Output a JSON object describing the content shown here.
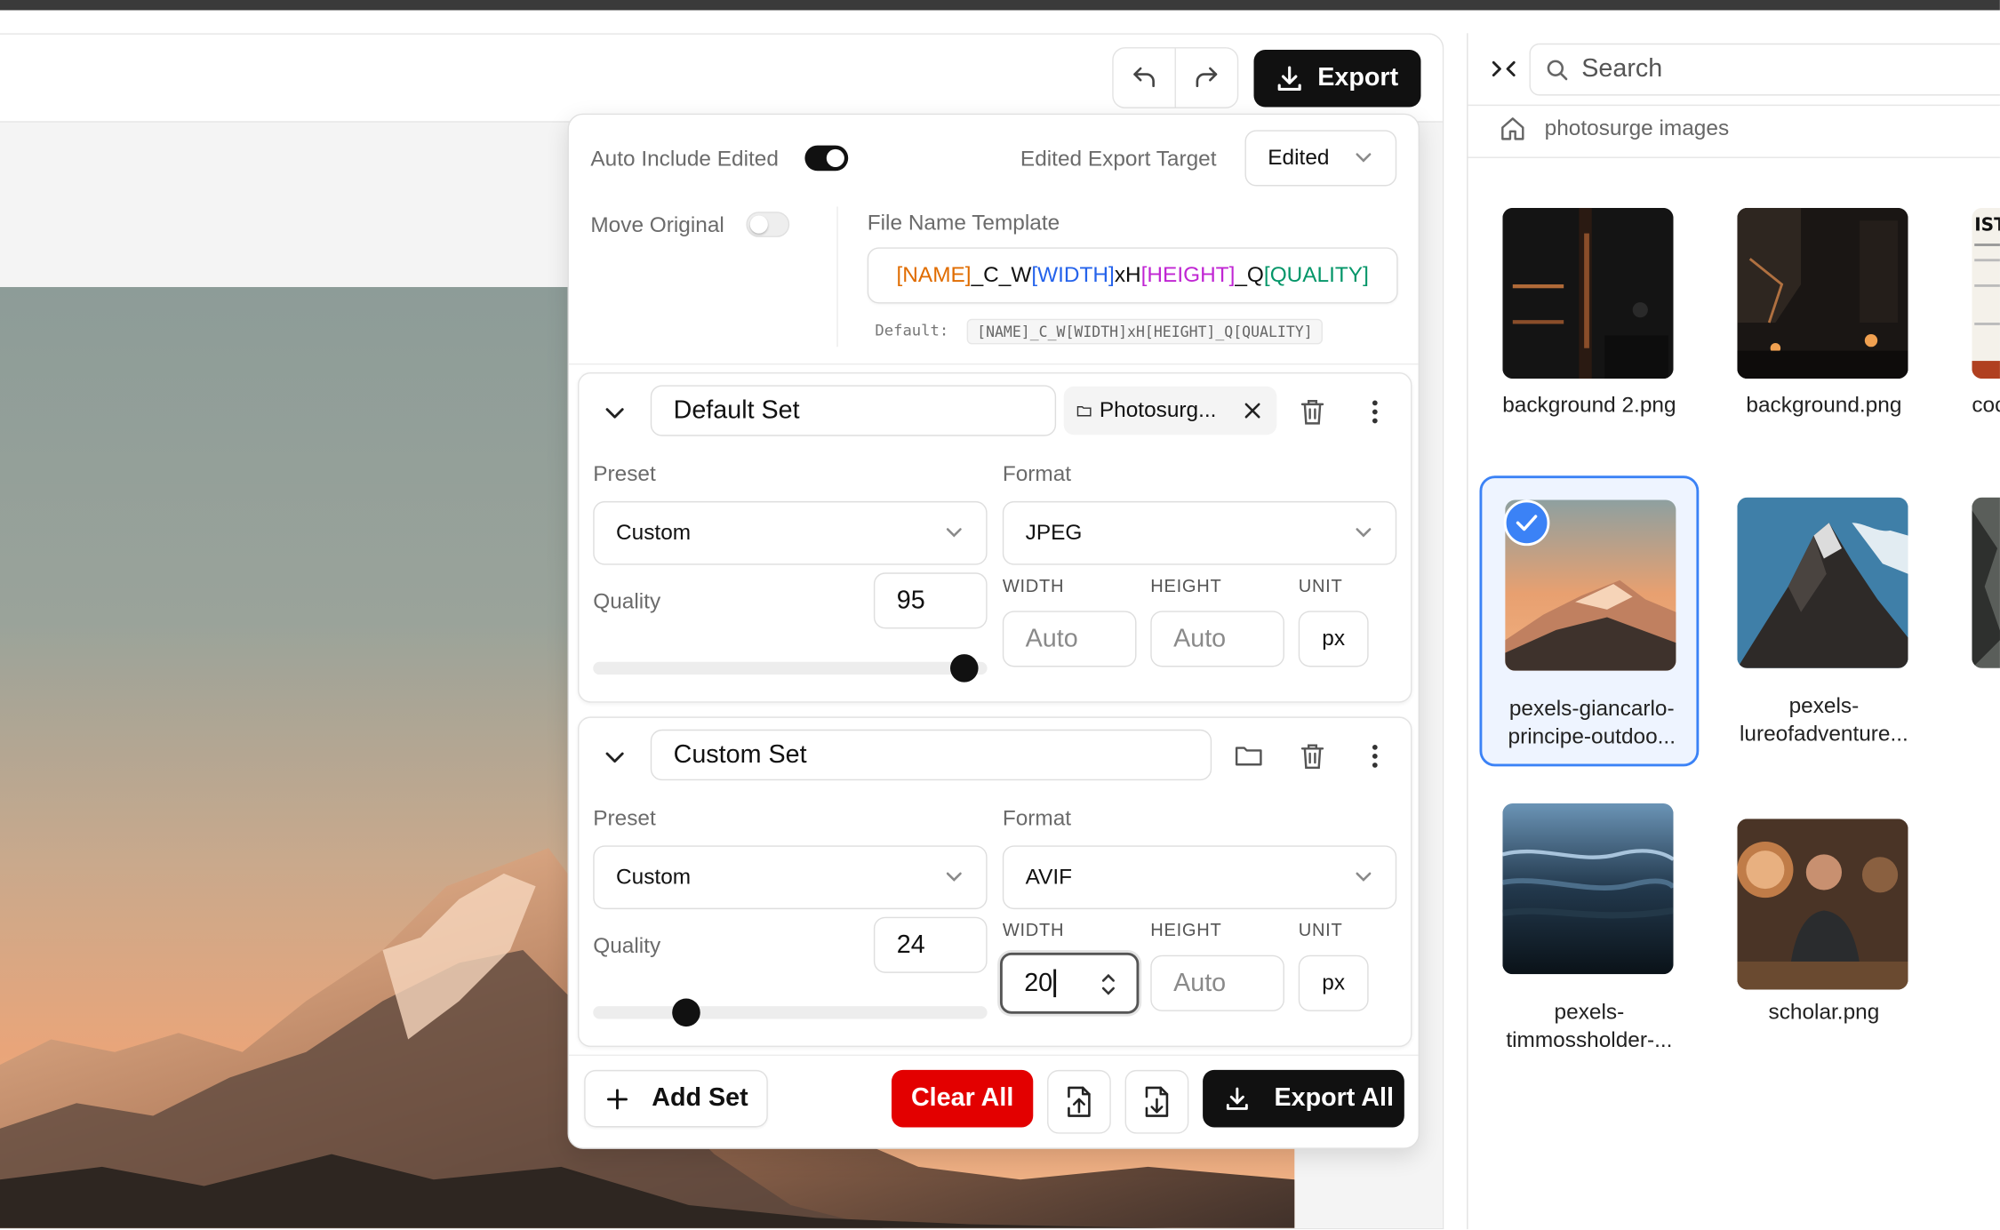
{
  "toolbar": {
    "export_label": "Export"
  },
  "export_panel": {
    "auto_include_label": "Auto Include Edited",
    "auto_include_on": true,
    "edited_target_label": "Edited Export Target",
    "edited_target_value": "Edited",
    "move_original_label": "Move Original",
    "move_original_on": false,
    "file_name_template_label": "File Name Template",
    "template_tokens": [
      "[NAME]",
      "_C_W",
      "[WIDTH]",
      "xH",
      "[HEIGHT]",
      "_Q",
      "[QUALITY]"
    ],
    "default_label": "Default:",
    "default_value": "[NAME]_C_W[WIDTH]xH[HEIGHT]_Q[QUALITY]",
    "sets": [
      {
        "name": "Default Set",
        "folder": "Photosurg...",
        "preset_label": "Preset",
        "preset_value": "Custom",
        "format_label": "Format",
        "format_value": "JPEG",
        "quality_label": "Quality",
        "quality_value": "95",
        "quality_fraction": 0.95,
        "width_label": "WIDTH",
        "width_value": "Auto",
        "height_label": "HEIGHT",
        "height_value": "Auto",
        "unit_label": "UNIT",
        "unit_value": "px"
      },
      {
        "name": "Custom Set",
        "preset_label": "Preset",
        "preset_value": "Custom",
        "format_label": "Format",
        "format_value": "AVIF",
        "quality_label": "Quality",
        "quality_value": "24",
        "quality_fraction": 0.24,
        "width_label": "WIDTH",
        "width_value": "20",
        "height_label": "HEIGHT",
        "height_value": "Auto",
        "unit_label": "UNIT",
        "unit_value": "px"
      }
    ],
    "add_set_label": "Add Set",
    "clear_all_label": "Clear All",
    "export_all_label": "Export All",
    "colors": {
      "name_token": "#e06c00",
      "width_token": "#2563eb",
      "height_token": "#c026d3",
      "quality_token": "#059669",
      "clear_all": "#e30000",
      "selected": "#3b82f6"
    }
  },
  "sidebar": {
    "search_placeholder": "Search",
    "breadcrumb": "photosurge images",
    "files": [
      {
        "caption_lines": [
          "background 2.png"
        ],
        "selected": false
      },
      {
        "caption_lines": [
          "background.png"
        ],
        "selected": false
      },
      {
        "caption_lines": [
          "coc"
        ],
        "selected": false
      },
      {
        "caption_lines": [
          "pexels-giancarlo-",
          "principe-outdoo..."
        ],
        "selected": true
      },
      {
        "caption_lines": [
          "pexels-",
          "lureofadventure..."
        ],
        "selected": false
      },
      {
        "caption_lines": [
          "pexels-",
          "timmossholder-..."
        ],
        "selected": false
      },
      {
        "caption_lines": [
          "scholar.png"
        ],
        "selected": false
      }
    ]
  }
}
